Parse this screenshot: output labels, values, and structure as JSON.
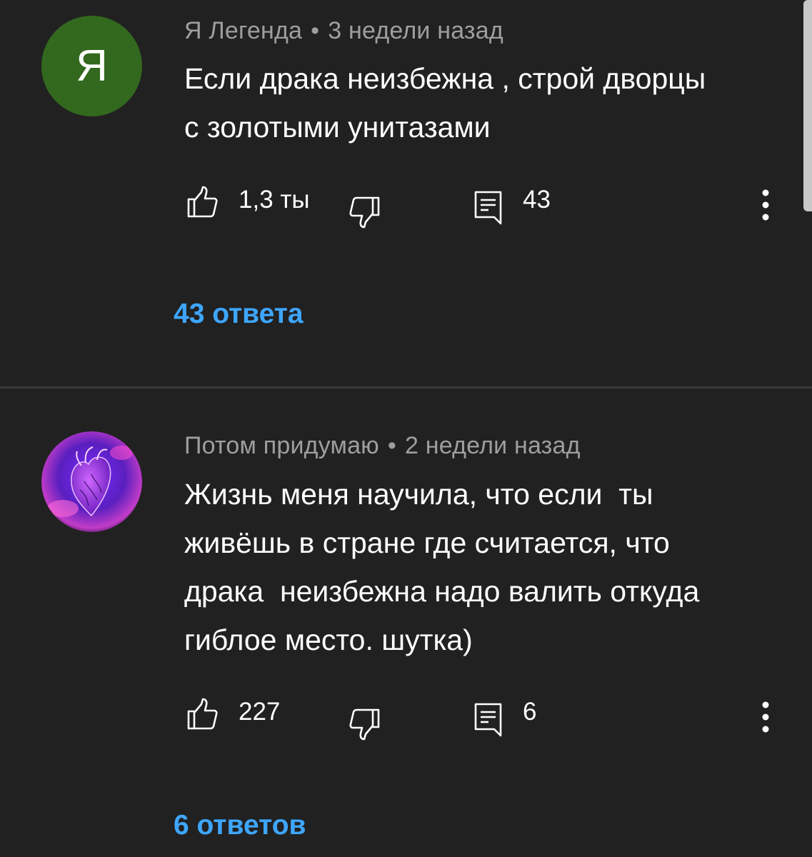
{
  "comments": [
    {
      "avatar_letter": "Я",
      "avatar_color": "#33691e",
      "author": "Я Легенда",
      "separator": "•",
      "time": "3 недели назад",
      "text": "Если драка неизбежна , строй дворцы\nс золотыми унитазами",
      "likes": "1,3 ты",
      "reply_count": "43",
      "replies_link": "43 ответа"
    },
    {
      "avatar_letter": "",
      "avatar_image": "purple-heart-avatar",
      "author": "Потом придумаю",
      "separator": "•",
      "time": "2 недели назад",
      "text": "Жизнь меня научила, что если  ты\nживёшь в стране где считается, что\nдрака  неизбежна надо валить откуда\nгиблое место. шутка)",
      "likes": "227",
      "reply_count": "6",
      "replies_link": "6 ответов"
    }
  ],
  "icons": {
    "like": "thumb-up-icon",
    "dislike": "thumb-down-icon",
    "reply": "comment-icon",
    "more": "more-vertical-icon"
  },
  "colors": {
    "background": "#212121",
    "link": "#3ea6ff",
    "meta": "#9e9e9e"
  }
}
